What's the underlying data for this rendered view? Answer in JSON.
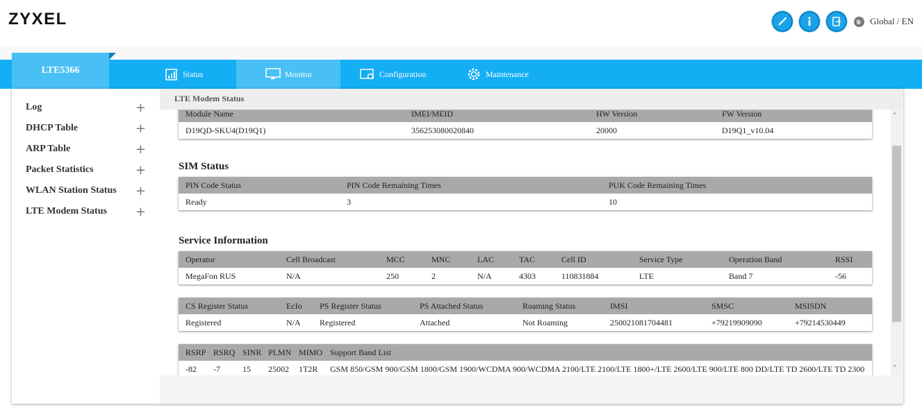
{
  "header": {
    "logo": "ZYXEL",
    "language": "Global / EN"
  },
  "nav": {
    "device": "LTE5366",
    "tabs": [
      {
        "label": "Status",
        "icon": "status-chart-icon"
      },
      {
        "label": "Monitor",
        "icon": "monitor-icon"
      },
      {
        "label": "Configuration",
        "icon": "configuration-icon"
      },
      {
        "label": "Maintenance",
        "icon": "maintenance-gear-icon"
      }
    ],
    "active_tab": "Monitor"
  },
  "sidebar": {
    "items": [
      {
        "label": "Log"
      },
      {
        "label": "DHCP Table"
      },
      {
        "label": "ARP Table"
      },
      {
        "label": "Packet Statistics"
      },
      {
        "label": "WLAN Station Status"
      },
      {
        "label": "LTE Modem Status"
      }
    ]
  },
  "breadcrumb": "LTE Modem Status",
  "module": {
    "headers": [
      "Module Name",
      "IMEI/MEID",
      "HW Version",
      "FW Version"
    ],
    "row": [
      "D19QD-SKU4(D19Q1)",
      "356253080020840",
      "20000",
      "D19Q1_v10.04"
    ]
  },
  "sim": {
    "title": "SIM Status",
    "headers": [
      "PIN Code Status",
      "PIN Code Remaining Times",
      "PUK Code Remaining Times"
    ],
    "row": [
      "Ready",
      "3",
      "10"
    ]
  },
  "service": {
    "title": "Service Information",
    "table1": {
      "headers": [
        "Operator",
        "Cell Broadcast",
        "MCC",
        "MNC",
        "LAC",
        "TAC",
        "Cell ID",
        "Service Type",
        "Operation Band",
        "RSSI"
      ],
      "row": [
        "MegaFon RUS",
        "N/A",
        "250",
        "2",
        "N/A",
        "4303",
        "110831884",
        "LTE",
        "Band 7",
        "-56"
      ]
    },
    "table2": {
      "headers": [
        "CS Register Status",
        "EcIo",
        "PS Register Status",
        "PS Attached Status",
        "Roaming Status",
        "IMSI",
        "SMSC",
        "MSISDN"
      ],
      "row": [
        "Registered",
        "N/A",
        "Registered",
        "Attached",
        "Not Roaming",
        "250021081704481",
        "+79219909090",
        "+79214530449"
      ]
    },
    "table3": {
      "headers": [
        "RSRP",
        "RSRQ",
        "SINR",
        "PLMN",
        "MIMO",
        "Support Band List"
      ],
      "row": [
        "-82",
        "-7",
        "15",
        "25002",
        "1T2R",
        "GSM 850/GSM 900/GSM 1800/GSM 1900/WCDMA 900/WCDMA 2100/LTE 2100/LTE 1800+/LTE 2600/LTE 900/LTE 800 DD/LTE TD 2600/LTE TD 2300"
      ]
    }
  },
  "colors": {
    "nav_blue": "#14aef5",
    "active_tab": "#48c0f5",
    "table_header": "#a9a9a9"
  }
}
